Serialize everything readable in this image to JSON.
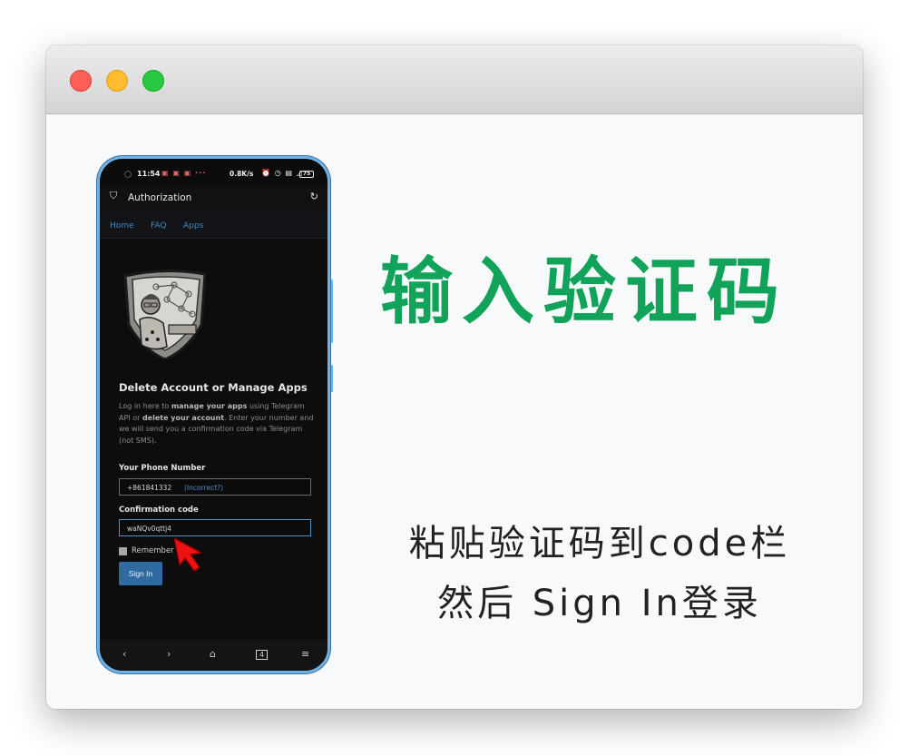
{
  "window": {
    "controls": [
      "close",
      "minimize",
      "zoom"
    ]
  },
  "phone": {
    "status": {
      "time": "11:54",
      "notifications": "▣ ▣ ▣ ···",
      "network_speed": "0.8K/s",
      "system_icons": "⏰ ◷ ▤ ◿",
      "battery": "75"
    },
    "appbar": {
      "title": "Authorization",
      "shield_icon": "shield-icon",
      "reload_icon": "reload-icon"
    },
    "nav": [
      "Home",
      "FAQ",
      "Apps"
    ],
    "heading": "Delete Account or Manage Apps",
    "description": {
      "p1": "Log in here to ",
      "b1": "manage your apps",
      "p2": " using Telegram API or ",
      "b2": "delete your account",
      "p3": ". Enter your number and we will send you a confirmation code via Telegram (not SMS)."
    },
    "phone_label": "Your Phone Number",
    "phone_value": "+861841332",
    "incorrect": "(Incorrect?)",
    "code_label": "Confirmation code",
    "code_value": "waNQv0qttj4",
    "remember": "Remember",
    "signin": "Sign In",
    "bottom_nav": [
      "‹",
      "›",
      "⌂",
      "4",
      "≡"
    ]
  },
  "headline": "输入验证码",
  "instructions": {
    "line1": "粘贴验证码到code栏",
    "line2": "然后 Sign In登录"
  },
  "colors": {
    "headline": "#12a35a",
    "phone_frame": "#6fb3e6",
    "link": "#3f88c5",
    "signin_bg": "#2f6aa0",
    "close": "#fe5f57",
    "minimize": "#febc2e",
    "zoom": "#28c840"
  }
}
